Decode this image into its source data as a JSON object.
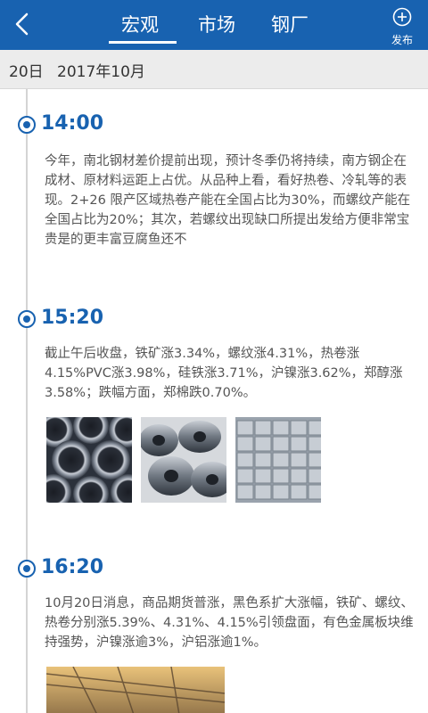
{
  "header": {
    "tabs": [
      "宏观",
      "市场",
      "钢厂"
    ],
    "active_tab": "宏观",
    "publish_label": "发布"
  },
  "date_bar": {
    "day": "20日",
    "month": "2017年10月"
  },
  "entries": [
    {
      "time": "14:00",
      "text": "今年，南北钢材差价提前出现，预计冬季仍将持续，南方钢企在成材、原材料运距上占优。从品种上看，看好热卷、冷轧等的表现。2+26 限产区域热卷产能在全国占比为30%，而螺纹产能在全国占比为20%；其次，若螺纹出现缺口所提出发给方便非常宝贵是的更丰富豆腐鱼还不"
    },
    {
      "time": "15:20",
      "text": "截止午后收盘，铁矿涨3.34%，螺纹涨4.31%，热卷涨4.15%PVC涨3.98%，硅铁涨3.71%，沪镍涨3.62%，郑醇涨3.58%；跌幅方面，郑棉跌0.70%。"
    },
    {
      "time": "16:20",
      "text": "10月20日消息，商品期货普涨，黑色系扩大涨幅，铁矿、螺纹、热卷分别涨5.39%、4.31%、4.15%引领盘面，有色金属板块维持强势，沪镍涨逾3%，沪铝涨逾1%。"
    }
  ],
  "colors": {
    "primary": "#1862b0",
    "background": "#ffffff",
    "date_bar": "#ececec",
    "body_text": "#555555"
  }
}
